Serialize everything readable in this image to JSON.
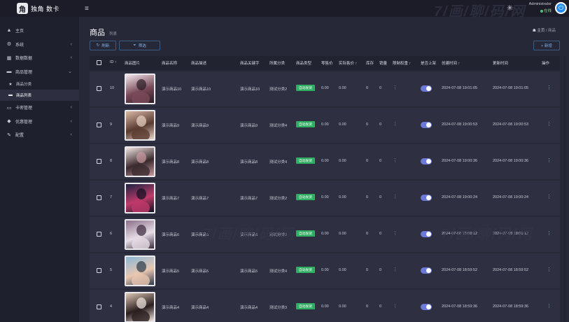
{
  "app": {
    "logo_glyph": "角",
    "title": "独角 数卡",
    "menu_icon": "hamburger-icon",
    "watermark": "7/画/聊/码/网"
  },
  "header": {
    "user_name": "Administrator",
    "user_status": "在线",
    "accent": "#1e8cf0"
  },
  "sidebar": {
    "items": [
      {
        "label": "主页",
        "icon": "dashboard-icon",
        "glyph": "▲",
        "arrow": ""
      },
      {
        "label": "系统",
        "icon": "gear-icon",
        "glyph": "⚙",
        "arrow": "‹"
      },
      {
        "label": "数据数据",
        "icon": "table-icon",
        "glyph": "▦",
        "arrow": "‹"
      },
      {
        "label": "商品管理",
        "icon": "shopping-bag-icon",
        "glyph": "▬",
        "arrow": "⌄"
      },
      {
        "label": "卡密管理",
        "icon": "card-icon",
        "glyph": "▭",
        "arrow": "‹"
      },
      {
        "label": "优惠管理",
        "icon": "gem-icon",
        "glyph": "◆",
        "arrow": "‹"
      },
      {
        "label": "配置",
        "icon": "wrench-icon",
        "glyph": "✎",
        "arrow": "‹"
      }
    ],
    "subitems": [
      {
        "label": "商品分类",
        "icon": "star-icon",
        "glyph": "★"
      },
      {
        "label": "商品列表",
        "icon": "shopping-bag-icon",
        "glyph": "▬"
      }
    ]
  },
  "page": {
    "title": "商品",
    "subtitle": "列表",
    "breadcrumb_home": "主页",
    "breadcrumb_sep": "/",
    "breadcrumb_current": "商品",
    "refresh_label": "刷新",
    "filter_label": "筛选",
    "add_label": "+ 新增"
  },
  "table": {
    "columns": [
      "ID",
      "商品图片",
      "商品名称",
      "商品描述",
      "商品关键字",
      "所属分类",
      "商品类型",
      "零售价",
      "实际售价",
      "库存",
      "销量",
      "限制权重",
      "是否上架",
      "创建时间",
      "更新时间",
      "操作"
    ],
    "rows": [
      {
        "id": "10",
        "name": "演示商品10",
        "desc": "演示商品10",
        "keyword": "演示商品10",
        "category": "测试分类2",
        "type": "自动发货",
        "retail": "0.00",
        "actual": "0.00",
        "stock": "0",
        "sales": "0",
        "created": "2024-07-08 19:01:05",
        "updated": "2024-07-08 19:01:05",
        "on_sale": true,
        "photo": [
          "#f3e6ea",
          "#7a4a5a",
          "#2a1c24"
        ]
      },
      {
        "id": "9",
        "name": "演示商品9",
        "desc": "演示商品9",
        "keyword": "演示商品9",
        "category": "测试分类4",
        "type": "自动发货",
        "retail": "0.00",
        "actual": "0.00",
        "stock": "0",
        "sales": "0",
        "created": "2024-07-08 19:00:53",
        "updated": "2024-07-08 19:00:53",
        "on_sale": true,
        "photo": [
          "#d9b8a6",
          "#5a3b30",
          "#e8d4c8"
        ]
      },
      {
        "id": "8",
        "name": "演示商品8",
        "desc": "演示商品8",
        "keyword": "演示商品8",
        "category": "测试分类4",
        "type": "自动发货",
        "retail": "0.00",
        "actual": "0.00",
        "stock": "0",
        "sales": "0",
        "created": "2024-07-08 19:00:36",
        "updated": "2024-07-08 19:00:36",
        "on_sale": true,
        "photo": [
          "#f1e4e0",
          "#3a2a2e",
          "#c99aa0"
        ]
      },
      {
        "id": "7",
        "name": "演示商品7",
        "desc": "演示商品7",
        "keyword": "演示商品7",
        "category": "测试分类2",
        "type": "自动发货",
        "retail": "0.00",
        "actual": "0.00",
        "stock": "0",
        "sales": "0",
        "created": "2024-07-08 19:00:24",
        "updated": "2024-07-08 19:00:24",
        "on_sale": true,
        "photo": [
          "#1a2240",
          "#c03a6a",
          "#0d1020"
        ]
      },
      {
        "id": "6",
        "name": "演示商品6",
        "desc": "演示商品6",
        "keyword": "演示商品6",
        "category": "测试分类3",
        "type": "自动发货",
        "retail": "0.00",
        "actual": "0.00",
        "stock": "0",
        "sales": "0",
        "created": "2024-07-08 19:00:12",
        "updated": "2024-07-08 19:00:12",
        "on_sale": true,
        "photo": [
          "#8a6e88",
          "#e6dde6",
          "#3a2a3a"
        ]
      },
      {
        "id": "5",
        "name": "演示商品5",
        "desc": "演示商品5",
        "keyword": "演示商品5",
        "category": "测试分类4",
        "type": "自动发货",
        "retail": "0.00",
        "actual": "0.00",
        "stock": "0",
        "sales": "0",
        "created": "2024-07-08 18:59:52",
        "updated": "2024-07-08 18:59:52",
        "on_sale": true,
        "photo": [
          "#8ab8d8",
          "#e9c6b0",
          "#2a3a4a"
        ]
      },
      {
        "id": "4",
        "name": "演示商品4",
        "desc": "演示商品4",
        "keyword": "演示商品4",
        "category": "测试分类3",
        "type": "自动发货",
        "retail": "0.00",
        "actual": "0.00",
        "stock": "0",
        "sales": "0",
        "created": "2024-07-08 18:59:36",
        "updated": "2024-07-08 18:59:36",
        "on_sale": true,
        "photo": [
          "#ddc6b4",
          "#2a1e1e",
          "#f2e8e0"
        ]
      }
    ]
  }
}
